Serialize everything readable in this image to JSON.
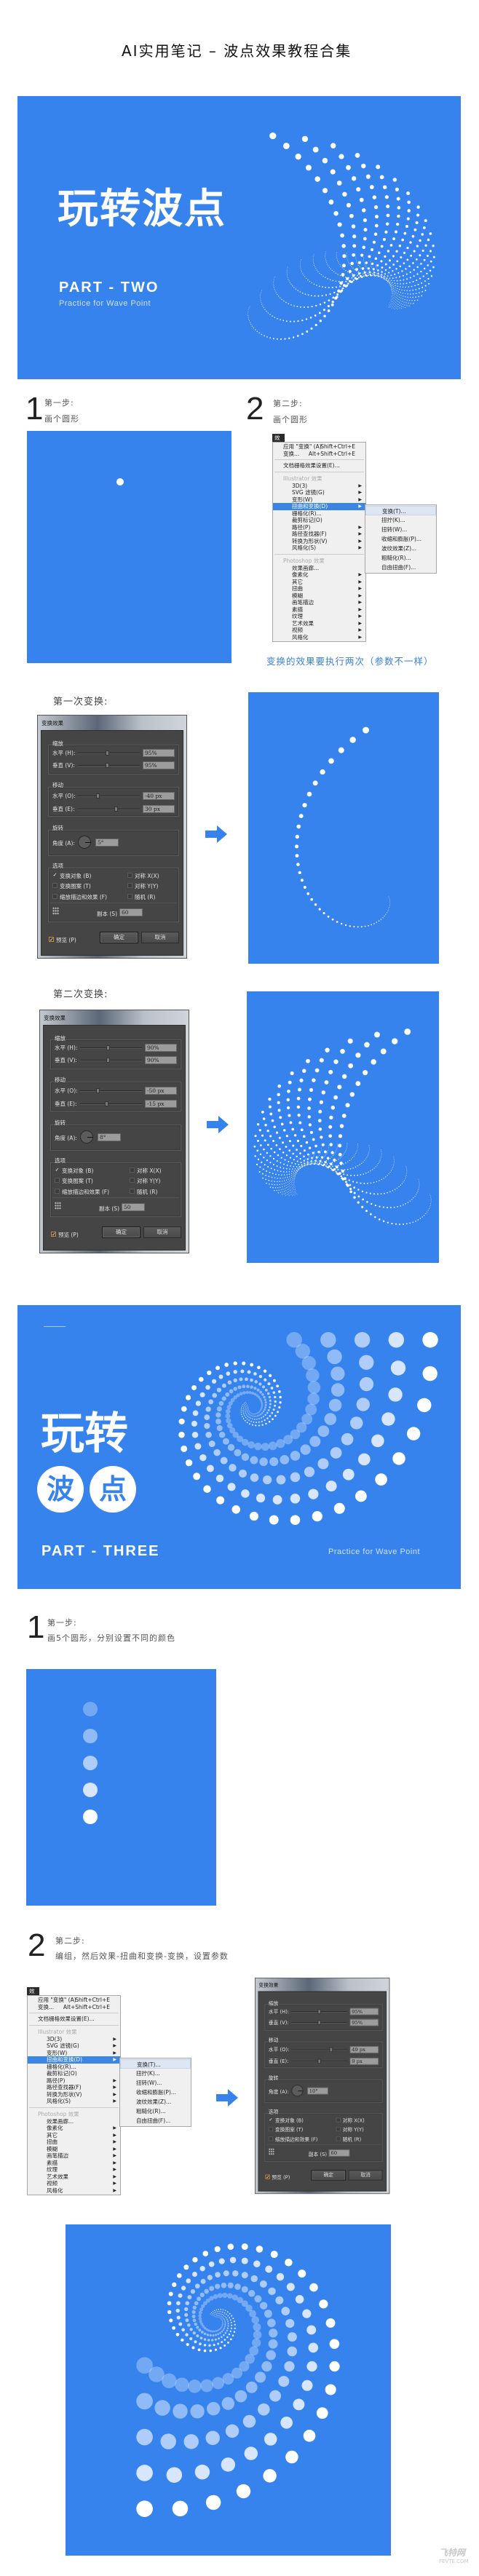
{
  "header": {
    "title": "AI实用笔记 – 波点效果教程合集"
  },
  "colors": {
    "brand_blue": "#3783ee",
    "caption_blue": "#3a7fd8",
    "dialog_bg": "#454545"
  },
  "part_two": {
    "title": "玩转波点",
    "part": "PART - TWO",
    "subtitle": "Practice for Wave Point",
    "step1": {
      "num": "1",
      "title": "第一步:",
      "desc": "画个圆形"
    },
    "step2": {
      "num": "2",
      "title": "第二步:",
      "desc": "画个圆形"
    },
    "caption": "变换的效果要执行两次（参数不一样）",
    "first_label": "第一次变换:",
    "second_label": "第二次变换:"
  },
  "part_three": {
    "title": "玩转",
    "circle1": "波",
    "circle2": "点",
    "part": "PART - THREE",
    "subtitle": "Practice for Wave Point",
    "step1": {
      "num": "1",
      "title": "第一步:",
      "desc": "画5个圆形，分别设置不同的颜色"
    },
    "step2": {
      "num": "2",
      "title": "第二步:",
      "desc": "编组，然后效果-扭曲和变换-变换，设置参数"
    },
    "dot_opacities": [
      0.3,
      0.45,
      0.6,
      0.8,
      1
    ]
  },
  "menu": {
    "tab": "效果(C)",
    "items": [
      {
        "type": "top",
        "label": "应用 \"变换\" (A)",
        "shortcut": "Shift+Ctrl+E"
      },
      {
        "type": "top",
        "label": "变换...",
        "shortcut": "Alt+Shift+Ctrl+E"
      },
      {
        "type": "sep"
      },
      {
        "type": "top",
        "label": "文档栅格效果设置(E)..."
      },
      {
        "type": "sep"
      },
      {
        "type": "section",
        "label": "Illustrator 效果"
      },
      {
        "type": "item",
        "label": "3D(3)",
        "arrow": true
      },
      {
        "type": "item",
        "label": "SVG 滤镜(G)",
        "arrow": true
      },
      {
        "type": "item",
        "label": "变形(W)",
        "arrow": true
      },
      {
        "type": "item",
        "label": "扭曲和变换(D)",
        "arrow": true,
        "highlighted": true
      },
      {
        "type": "item",
        "label": "栅格化(R)..."
      },
      {
        "type": "item",
        "label": "裁剪标记(O)"
      },
      {
        "type": "item",
        "label": "路径(P)",
        "arrow": true
      },
      {
        "type": "item",
        "label": "路径查找器(F)",
        "arrow": true
      },
      {
        "type": "item",
        "label": "转换为形状(V)",
        "arrow": true
      },
      {
        "type": "item",
        "label": "风格化(S)",
        "arrow": true
      },
      {
        "type": "sep"
      },
      {
        "type": "section",
        "label": "Photoshop 效果"
      },
      {
        "type": "item",
        "label": "效果画廊..."
      },
      {
        "type": "item",
        "label": "像素化",
        "arrow": true
      },
      {
        "type": "item",
        "label": "其它",
        "arrow": true
      },
      {
        "type": "item",
        "label": "扭曲",
        "arrow": true
      },
      {
        "type": "item",
        "label": "模糊",
        "arrow": true
      },
      {
        "type": "item",
        "label": "画笔描边",
        "arrow": true
      },
      {
        "type": "item",
        "label": "素描",
        "arrow": true
      },
      {
        "type": "item",
        "label": "纹理",
        "arrow": true
      },
      {
        "type": "item",
        "label": "艺术效果",
        "arrow": true
      },
      {
        "type": "item",
        "label": "视频",
        "arrow": true
      },
      {
        "type": "item",
        "label": "风格化",
        "arrow": true
      }
    ],
    "submenu": [
      {
        "label": "变换(T)...",
        "highlighted": true
      },
      {
        "label": "扭拧(K)..."
      },
      {
        "label": "扭转(W)..."
      },
      {
        "label": "收缩和膨胀(P)..."
      },
      {
        "label": "波纹效果(Z)..."
      },
      {
        "label": "粗糙化(R)..."
      },
      {
        "label": "自由扭曲(F)..."
      }
    ]
  },
  "dialog_labels": {
    "title": "变换效果",
    "scale": "缩放",
    "h_scale": "水平 (H):",
    "v_scale": "垂直 (V):",
    "move": "移动",
    "h_move": "水平 (O):",
    "v_move": "垂直 (E):",
    "rotate": "旋转",
    "angle": "角度 (A):",
    "options": "选项",
    "opt_obj": "变换对象 (B)",
    "opt_pat": "变换图案 (T)",
    "opt_stroke": "缩放描边和效果 (F)",
    "opt_x": "对称 X(X)",
    "opt_y": "对称 Y(Y)",
    "opt_rand": "随机 (R)",
    "copies": "副本 (S)",
    "preview": "预览 (P)",
    "ok": "确定",
    "cancel": "取消"
  },
  "dialogs": [
    {
      "h_scale": "95%",
      "v_scale": "95%",
      "h_move": "-40 px",
      "v_move": "30 px",
      "angle": "5°",
      "copies": "60",
      "sliders": {
        "h_scale": 0.47,
        "v_scale": 0.47,
        "h_move": 0.31,
        "v_move": 0.63
      },
      "transform_objects": true,
      "preview": true
    },
    {
      "h_scale": "90%",
      "v_scale": "90%",
      "h_move": "-50 px",
      "v_move": "-15 px",
      "angle": "8°",
      "copies": "50",
      "sliders": {
        "h_scale": 0.45,
        "v_scale": 0.45,
        "h_move": 0.27,
        "v_move": 0.42
      },
      "transform_objects": true,
      "preview": true
    },
    {
      "h_scale": "95%",
      "v_scale": "95%",
      "h_move": "49 px",
      "v_move": "9 px",
      "angle": "10°",
      "copies": "60",
      "sliders": {
        "h_scale": 0.5,
        "v_scale": 0.5,
        "h_move": 0.72,
        "v_move": 0.5
      },
      "transform_objects": true,
      "preview": true
    }
  ],
  "watermark": {
    "name": "飞特网",
    "url": "FEVTE.COM"
  }
}
